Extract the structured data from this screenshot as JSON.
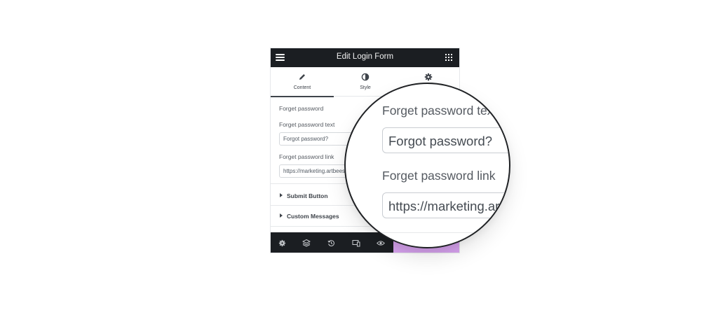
{
  "panel": {
    "title": "Edit Login Form",
    "tabs": [
      {
        "label": "Content",
        "icon": "pencil-icon"
      },
      {
        "label": "Style",
        "icon": "contrast-icon"
      },
      {
        "label": "",
        "icon": "gear-icon"
      }
    ],
    "section_heading": "Forget password",
    "forget_text_label": "Forget password text",
    "forget_text_value": "Forgot password?",
    "forget_link_label": "Forget password link",
    "forget_link_value": "https://marketing.artbees.net/",
    "accordions": [
      {
        "label": "Submit Button"
      },
      {
        "label": "Custom Messages"
      }
    ]
  },
  "magnifier": {
    "text_label": "Forget password text",
    "text_value": "Forgot password?",
    "link_label": "Forget password link",
    "link_value": "https://marketing.artbees.net/"
  },
  "bottombar": {
    "icons": [
      "gear-icon",
      "layers-icon",
      "history-icon",
      "responsive-icon",
      "eye-icon"
    ]
  },
  "colors": {
    "dark_bar": "#1b1e22",
    "publish": "#d7a2ee",
    "text": "#3f444b"
  }
}
